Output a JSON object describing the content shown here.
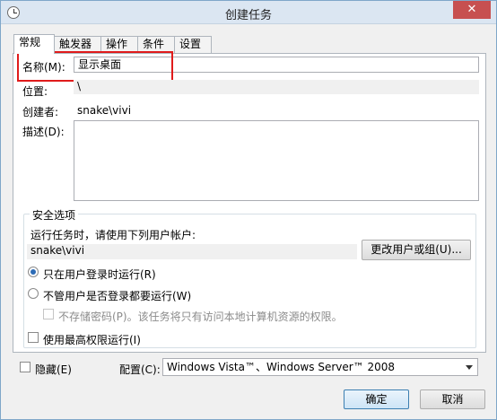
{
  "window": {
    "title": "创建任务",
    "close_label": "✕"
  },
  "tabs": [
    {
      "label": "常规",
      "active": true
    },
    {
      "label": "触发器"
    },
    {
      "label": "操作"
    },
    {
      "label": "条件"
    },
    {
      "label": "设置"
    }
  ],
  "general": {
    "name_label": "名称(M):",
    "name_value": "显示桌面",
    "location_label": "位置:",
    "location_value": "\\",
    "author_label": "创建者:",
    "author_value": "snake\\vivi",
    "description_label": "描述(D):",
    "description_value": ""
  },
  "security": {
    "group_title": "安全选项",
    "run_as_prompt": "运行任务时，请使用下列用户帐户:",
    "user_account": "snake\\vivi",
    "change_user_button": "更改用户或组(U)...",
    "option_logged_on": "只在用户登录时运行(R)",
    "option_whether_logged_on": "不管用户是否登录都要运行(W)",
    "do_not_store_password": "不存储密码(P)。该任务将只有访问本地计算机资源的权限。",
    "highest_privileges": "使用最高权限运行(I)"
  },
  "footer": {
    "hidden_label": "隐藏(E)",
    "configure_label": "配置(C):",
    "configure_value": "Windows Vista™、Windows Server™ 2008",
    "ok_button": "确定",
    "cancel_button": "取消"
  }
}
